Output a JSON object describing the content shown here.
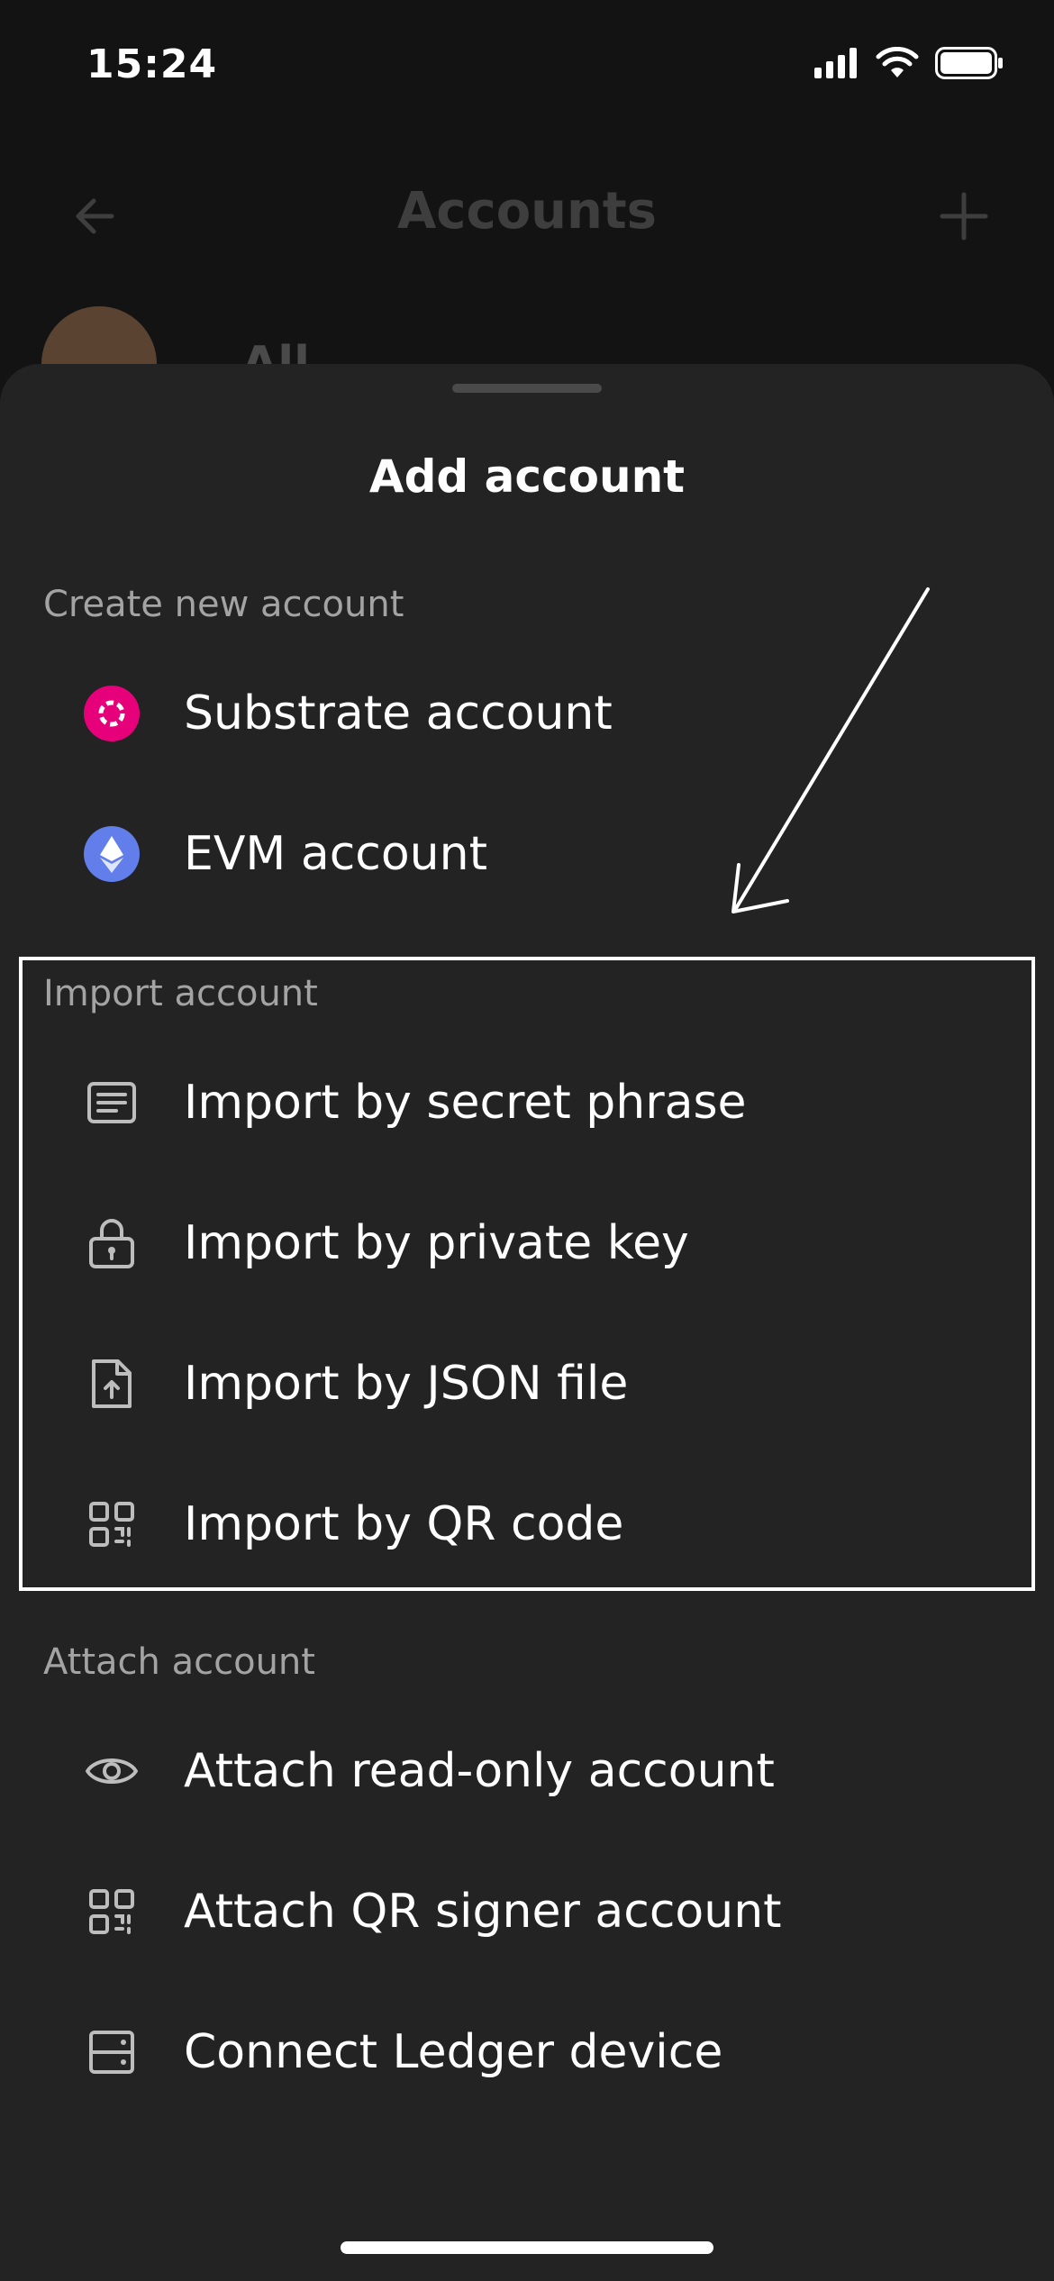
{
  "status": {
    "time": "15:24"
  },
  "nav": {
    "title": "Accounts"
  },
  "peek": {
    "label": "All"
  },
  "sheet": {
    "title": "Add account",
    "create": {
      "label": "Create new account",
      "items": [
        {
          "label": "Substrate account",
          "icon": "polkadot-icon"
        },
        {
          "label": "EVM account",
          "icon": "ethereum-icon"
        }
      ]
    },
    "import": {
      "label": "Import account",
      "items": [
        {
          "label": "Import by secret phrase",
          "icon": "document-lines-icon"
        },
        {
          "label": "Import by private key",
          "icon": "lock-icon"
        },
        {
          "label": "Import by JSON file",
          "icon": "file-upload-icon"
        },
        {
          "label": "Import by QR code",
          "icon": "qr-code-icon"
        }
      ]
    },
    "attach": {
      "label": "Attach account",
      "items": [
        {
          "label": "Attach read-only account",
          "icon": "eye-icon"
        },
        {
          "label": "Attach QR signer account",
          "icon": "qr-code-icon"
        },
        {
          "label": "Connect Ledger device",
          "icon": "ledger-device-icon"
        }
      ]
    }
  },
  "colors": {
    "background": "#131313",
    "sheet": "#232323",
    "polkadot": "#e6007a",
    "ethereum": "#627eea",
    "section": "#a3a3a3"
  }
}
